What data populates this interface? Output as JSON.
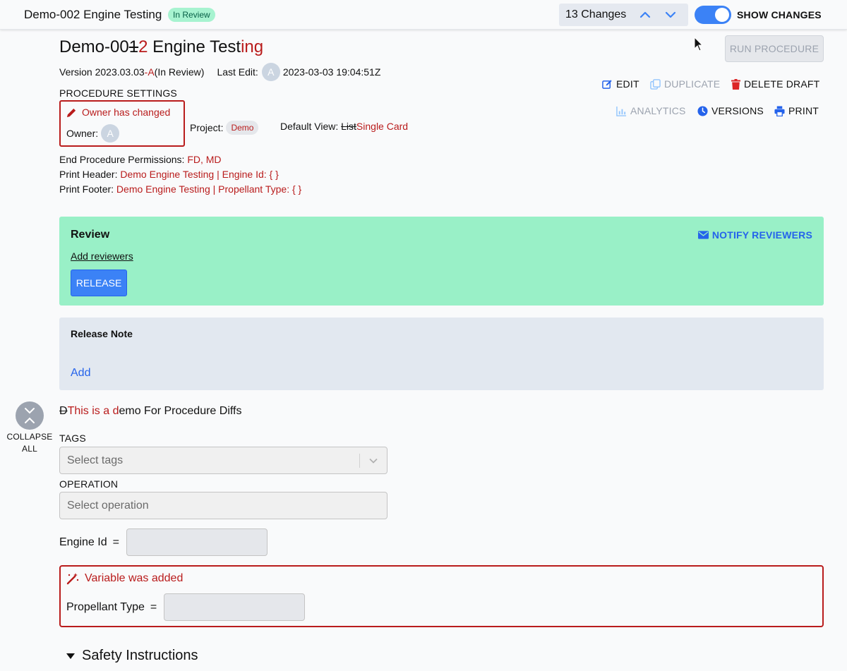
{
  "topbar": {
    "title": "Demo-002 Engine Testing",
    "status_badge": "In Review",
    "changes_count": "13 Changes",
    "show_changes_label": "SHOW CHANGES",
    "show_changes_on": true
  },
  "header": {
    "title_prefix": "Demo-00",
    "title_removed": "1",
    "title_added": "2",
    "title_mid": " Engine Test",
    "title_added2": "ing",
    "version_label": "Version 2023.03.03",
    "version_suffix": "-A",
    "version_state": " (In Review)",
    "last_edit_label": "Last Edit:",
    "last_edit_avatar": "A",
    "last_edit_time": "2023-03-03 19:04:51Z",
    "run_button": "RUN PROCEDURE"
  },
  "actions": {
    "edit": "EDIT",
    "duplicate": "DUPLICATE",
    "delete_draft": "DELETE DRAFT",
    "analytics": "ANALYTICS",
    "versions": "VERSIONS",
    "print": "PRINT"
  },
  "settings": {
    "heading": "PROCEDURE SETTINGS",
    "owner_changed": "Owner has changed",
    "owner_label": "Owner:",
    "owner_avatar": "A",
    "project_label": "Project:",
    "project_value": "Demo",
    "default_view_label": "Default View: ",
    "default_view_old": "List",
    "default_view_new": "Single Card",
    "end_permissions_label": "End Procedure Permissions: ",
    "end_permissions_value": "FD, MD",
    "print_header_label": "Print Header: ",
    "print_header_value": "Demo Engine Testing | Engine Id: { }",
    "print_footer_label": "Print Footer: ",
    "print_footer_value": "Demo Engine Testing | Propellant Type: { }"
  },
  "review": {
    "title": "Review",
    "notify": "NOTIFY REVIEWERS",
    "add_reviewers": "Add reviewers",
    "release_button": "RELEASE"
  },
  "release_note": {
    "title": "Release Note",
    "add": "Add"
  },
  "collapse": {
    "line1": "COLLAPSE",
    "line2": "ALL"
  },
  "description": {
    "removed": "D",
    "added": "This is a d",
    "rest": "emo For Procedure Diffs"
  },
  "fields": {
    "tags_label": "TAGS",
    "tags_placeholder": "Select tags",
    "operation_label": "OPERATION",
    "operation_placeholder": "Select operation",
    "engine_id_label": "Engine Id",
    "equals": "=",
    "variable_added": "Variable was added",
    "propellant_label": "Propellant Type"
  },
  "sections": {
    "safety": "Safety Instructions"
  },
  "colors": {
    "accent_blue": "#3b82f6",
    "diff_red": "#b91c1c",
    "review_green": "#99f0c7",
    "note_gray": "#e2e8f0"
  }
}
